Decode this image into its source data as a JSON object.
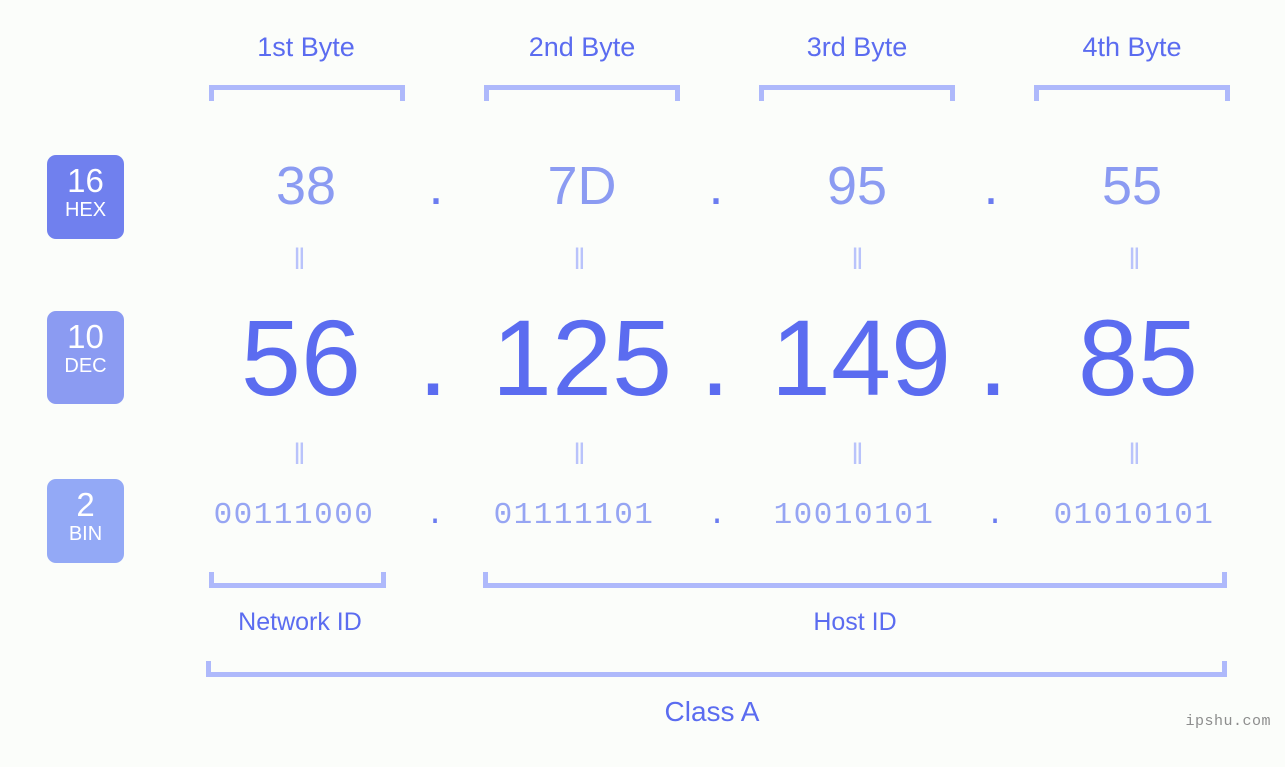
{
  "page": {
    "background_color": "#fbfdfa",
    "accent_color": "#5b6cf0",
    "bracket_color": "#aeb9fb",
    "watermark": "ipshu.com"
  },
  "columns": [
    {
      "header": "1st Byte"
    },
    {
      "header": "2nd Byte"
    },
    {
      "header": "3rd Byte"
    },
    {
      "header": "4th Byte"
    }
  ],
  "rows": {
    "hex": {
      "badge_number": "16",
      "badge_label": "HEX",
      "badge_color": "#7080ee",
      "values": [
        "38",
        "7D",
        "95",
        "55"
      ],
      "separator": "."
    },
    "dec": {
      "badge_number": "10",
      "badge_label": "DEC",
      "badge_color": "#8b9bf2",
      "values": [
        "56",
        "125",
        "149",
        "85"
      ],
      "separator": "."
    },
    "bin": {
      "badge_number": "2",
      "badge_label": "BIN",
      "badge_color": "#93a9f6",
      "values": [
        "00111000",
        "01111101",
        "10010101",
        "01010101"
      ],
      "separator": "."
    }
  },
  "equals_marks": {
    "glyph": "‖",
    "color": "#b9c3fb",
    "count_per_row": 4
  },
  "footer": {
    "network_id_label": "Network ID",
    "host_id_label": "Host ID",
    "class_label": "Class A"
  },
  "ip_address": {
    "hex": "38.7D.95.55",
    "dec": "56.125.149.85",
    "bin": "00111000.01111101.10010101.01010101",
    "class": "Class A",
    "network_id_bytes": 1,
    "host_id_bytes": 3
  }
}
